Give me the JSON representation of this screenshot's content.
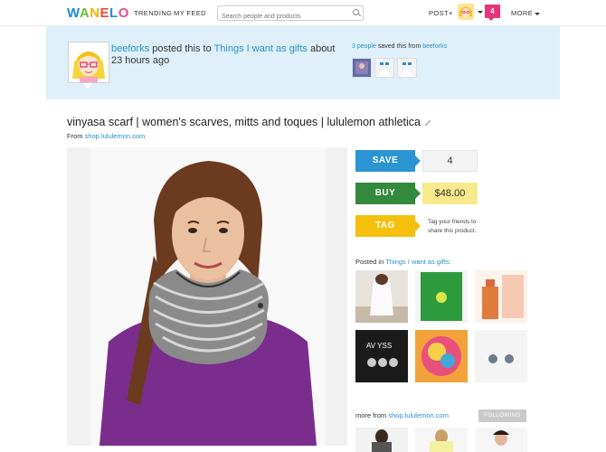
{
  "header": {
    "logo": "WANELO",
    "nav": [
      "TRENDING",
      "MY FEED"
    ],
    "search_placeholder": "Search people and products",
    "post_label": "POST+",
    "notification_count": "4",
    "more_label": "MORE"
  },
  "activity": {
    "user": "beeforks",
    "verb": "posted this to",
    "collection": "Things I want as gifts",
    "time": "about 23 hours ago",
    "saved_count": "3 people",
    "saved_text": "saved this from",
    "saved_from": "beeforks"
  },
  "product": {
    "title": "vinyasa scarf | women's scarves, mitts and toques | lululemon athletica",
    "from_label": "From",
    "source": "shop.lululemon.com",
    "save_label": "SAVE",
    "save_count": "4",
    "buy_label": "BUY",
    "price": "$48.00",
    "tag_label": "TAG",
    "tag_help": "Tag your friends to share this product."
  },
  "posted_in": {
    "label": "Posted in",
    "collection": "Things I want as gifts:",
    "items": [
      "tank-top-photo",
      "green-card-photo",
      "bottle-illustration",
      "tshirt-photo",
      "colorful-scarf-photo",
      "earrings-photo"
    ]
  },
  "more_from": {
    "label": "more from",
    "source": "shop.lululemon.com",
    "following_label": "FOLLOWING"
  },
  "colors": {
    "save": "#2b94d3",
    "buy": "#33893c",
    "tag": "#f4c00d",
    "price_bg": "#f7ea8c",
    "notif": "#e8337a",
    "banner": "#dff0fb"
  }
}
